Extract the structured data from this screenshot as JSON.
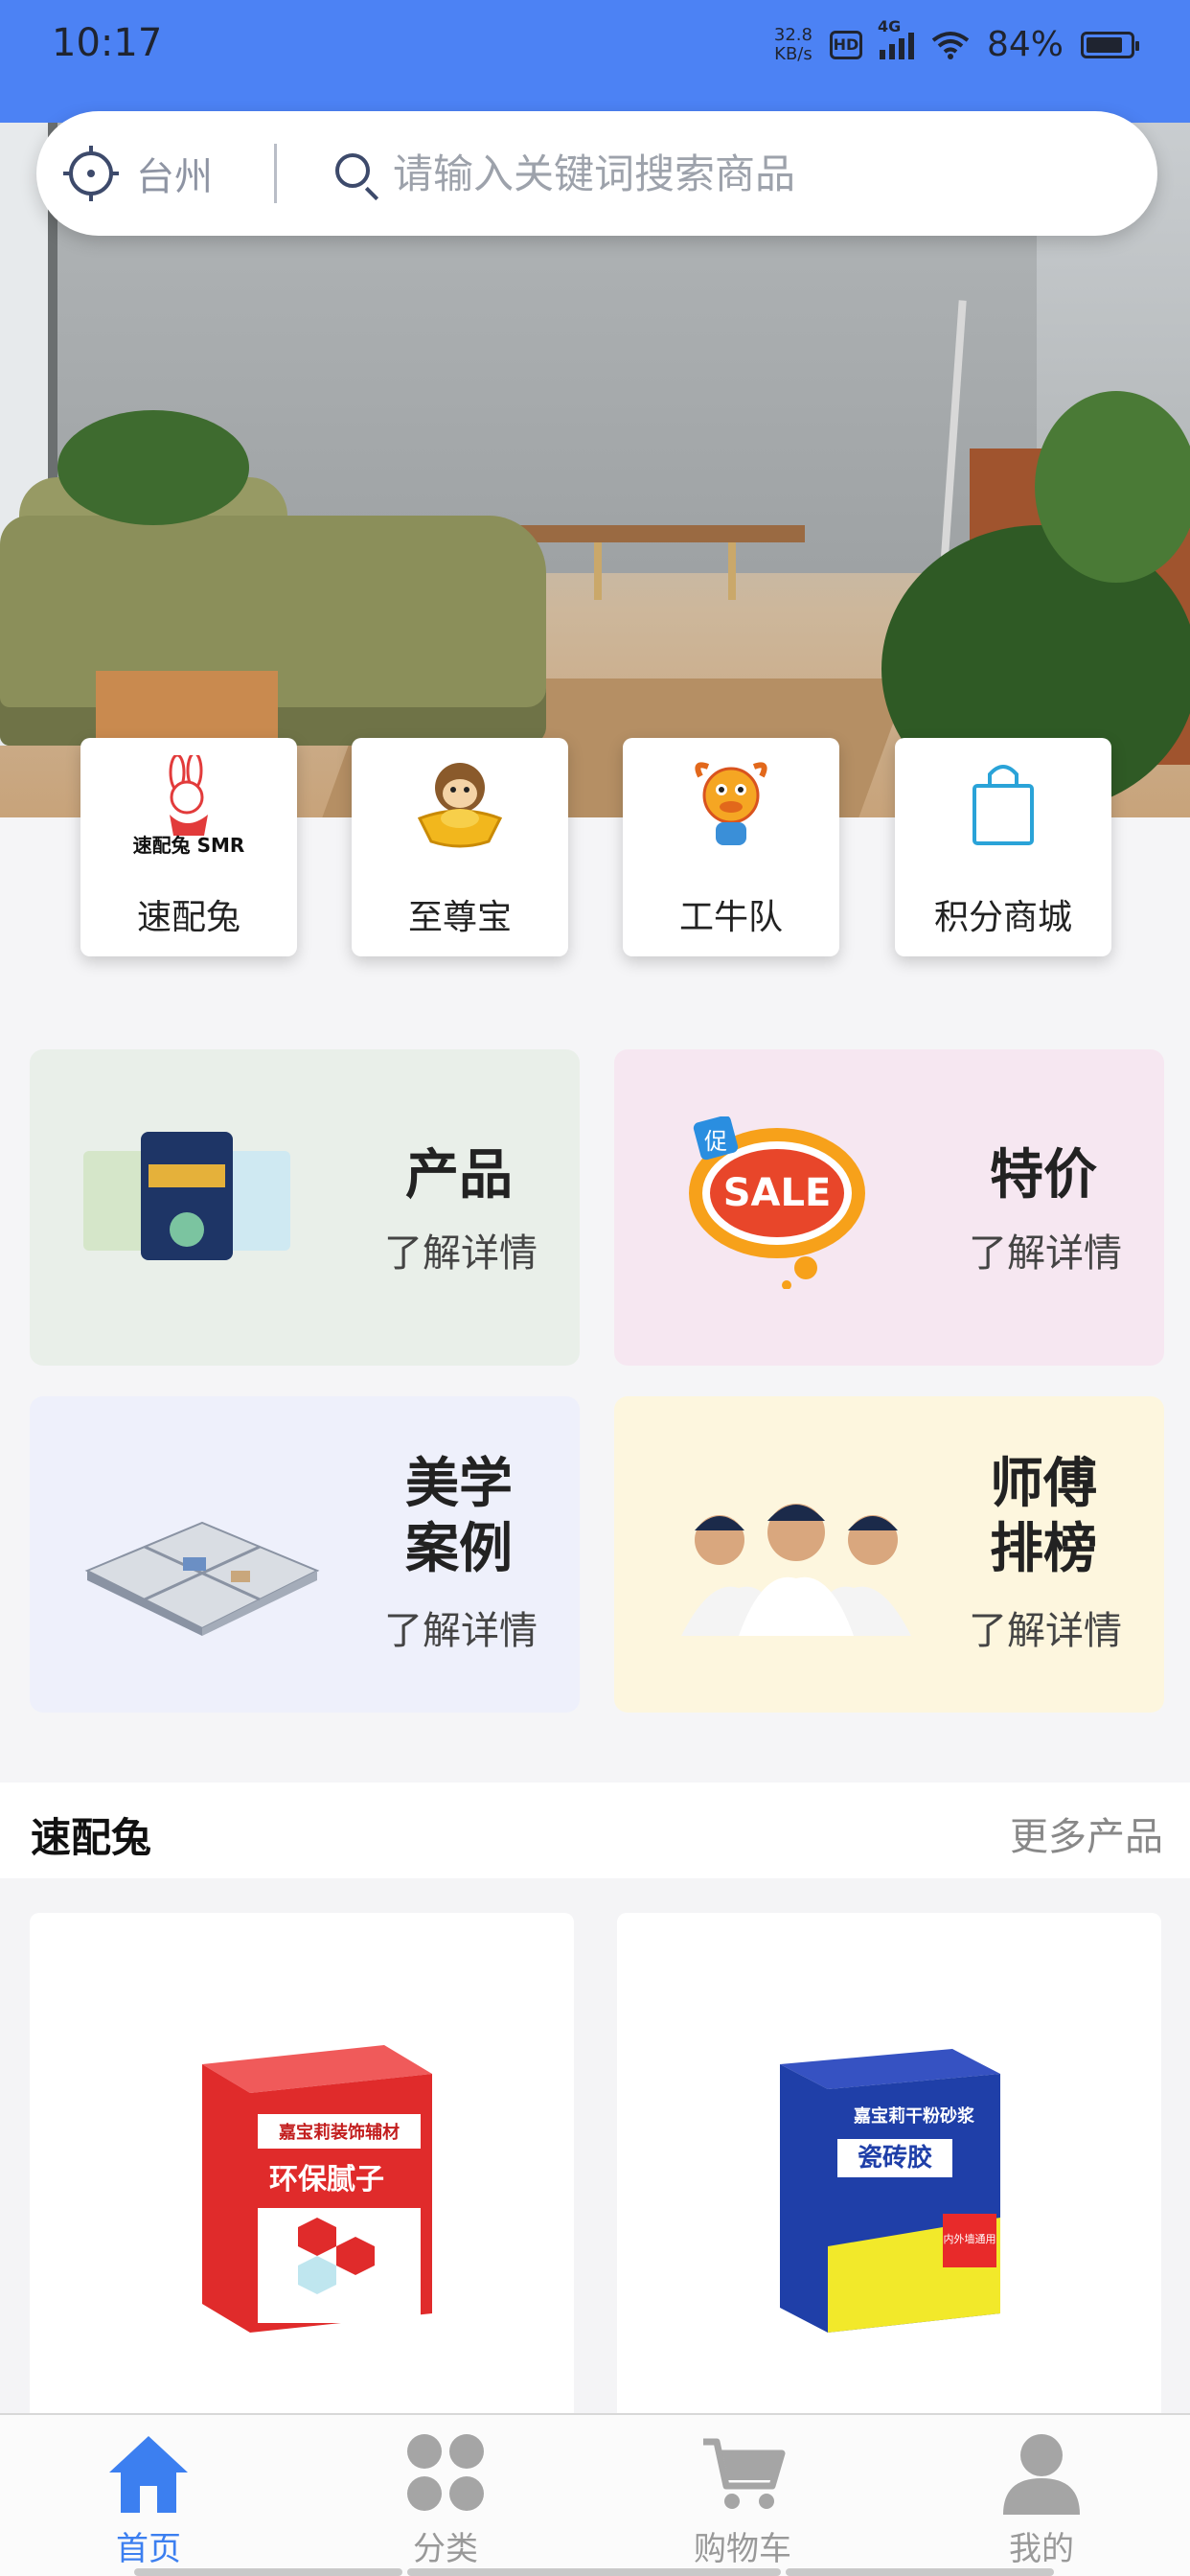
{
  "status_bar": {
    "time": "10:17",
    "net_speed_value": "32.8",
    "net_speed_unit": "KB/s",
    "hd_badge": "HD",
    "network": "4G",
    "battery_percent": "84%",
    "battery_level": 0.84
  },
  "search": {
    "city": "台州",
    "placeholder": "请输入关键词搜索商品"
  },
  "quick_links": [
    {
      "label": "速配兔",
      "logo_text": "速配兔 SMR",
      "icon": "rabbit-logo-icon"
    },
    {
      "label": "至尊宝",
      "icon": "monkey-gold-ingot-icon"
    },
    {
      "label": "工牛队",
      "icon": "bull-mascot-icon"
    },
    {
      "label": "积分商城",
      "icon": "shopping-bag-icon"
    }
  ],
  "categories": [
    {
      "title": "产品",
      "subtitle": "了解详情",
      "bg": "#e9efe9",
      "image": "paint-buckets-image"
    },
    {
      "title": "特价",
      "subtitle": "了解详情",
      "bg": "#f6e7f1",
      "image": "sale-bubble-image",
      "badge_text": "促",
      "sale_text": "SALE"
    },
    {
      "title": "美学\n案例",
      "subtitle": "了解详情",
      "bg": "#eef0fb",
      "image": "floor-plan-3d-image"
    },
    {
      "title": "师傅\n排榜",
      "subtitle": "了解详情",
      "bg": "#fdf6de",
      "image": "workers-photo-image"
    }
  ],
  "section": {
    "title": "速配兔",
    "more_label": "更多产品"
  },
  "products": [
    {
      "name": "环保腻子",
      "brand": "嘉宝莉装饰辅材",
      "color": "#e02b2b"
    },
    {
      "name": "瓷砖胶",
      "brand": "嘉宝莉干粉砂浆",
      "color": "#1f3fa8",
      "accent": "#f2e92a",
      "tag": "内外墙通用"
    }
  ],
  "tabbar": [
    {
      "label": "首页",
      "icon": "home-icon",
      "active": true
    },
    {
      "label": "分类",
      "icon": "grid-icon",
      "active": false
    },
    {
      "label": "购物车",
      "icon": "cart-icon",
      "active": false
    },
    {
      "label": "我的",
      "icon": "user-icon",
      "active": false
    }
  ],
  "colors": {
    "accent": "#3c7ff0",
    "status_bar_bg": "#4c82f4",
    "tab_inactive": "#999999"
  }
}
